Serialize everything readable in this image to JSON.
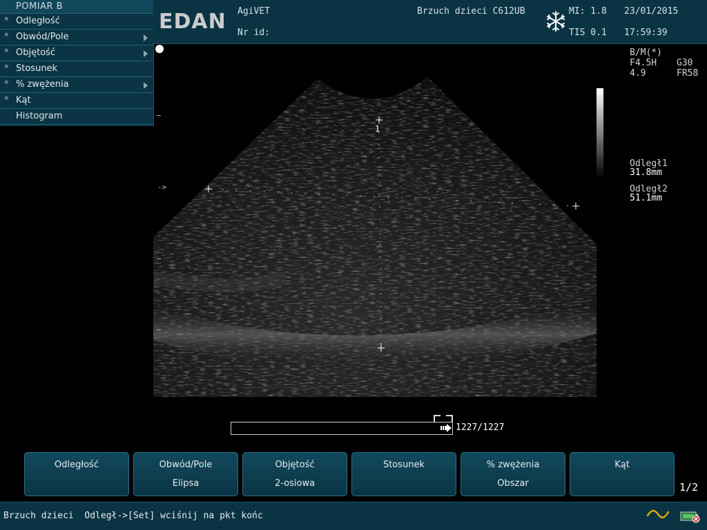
{
  "menu": {
    "title": "POMIAR B",
    "items": [
      {
        "star": "*",
        "label": "Odległość",
        "submenu": false
      },
      {
        "star": "*",
        "label": "Obwód/Pole",
        "submenu": true
      },
      {
        "star": "*",
        "label": "Objętość",
        "submenu": true
      },
      {
        "star": "*",
        "label": "Stosunek",
        "submenu": false
      },
      {
        "star": "*",
        "label": "% zwężenia",
        "submenu": true
      },
      {
        "star": "*",
        "label": "Kąt",
        "submenu": false
      },
      {
        "star": "",
        "label": "Histogram",
        "submenu": false
      }
    ]
  },
  "header": {
    "logo": "EDAN",
    "hospital": "AgiVET",
    "id_label": "Nr id:",
    "exam": "Brzuch dzieci C612UB",
    "mi": "MI: 1.8",
    "tis": "TIS 0.1",
    "date": "23/01/2015",
    "time": "17:59:39",
    "freeze_icon": "snowflake-icon"
  },
  "image_params": {
    "mode": "B/M(*)",
    "freq": "F4.5H",
    "gain": "G30",
    "depth": "4.9",
    "frame_rate": "FR58"
  },
  "measurements": {
    "m1_label": "Odległ1",
    "m1_value": "31.8mm",
    "m2_label": "Odległ2",
    "m2_value": "51.1mm",
    "caliper_number": "1",
    "focus_marker": "->"
  },
  "cine": {
    "counter": "1227/1227",
    "position_fraction": 1.0
  },
  "softkeys": [
    {
      "line1": "Odległość",
      "line2": ""
    },
    {
      "line1": "Obwód/Pole",
      "line2": "Elipsa"
    },
    {
      "line1": "Objętość",
      "line2": "2-osiowa"
    },
    {
      "line1": "Stosunek",
      "line2": ""
    },
    {
      "line1": "% zwężenia",
      "line2": "Obszar"
    },
    {
      "line1": "Kąt",
      "line2": ""
    }
  ],
  "pager": "1/2",
  "status": {
    "text": "Brzuch dzieci  Odległ->[Set] wciśnij na pkt końc",
    "icons": [
      "wave-icon",
      "battery-plug-icon"
    ]
  },
  "colors": {
    "panel": "#0a3444",
    "panel_border": "#1d5568",
    "softkey_border": "#2b6f85",
    "wave": "#e0a800"
  }
}
